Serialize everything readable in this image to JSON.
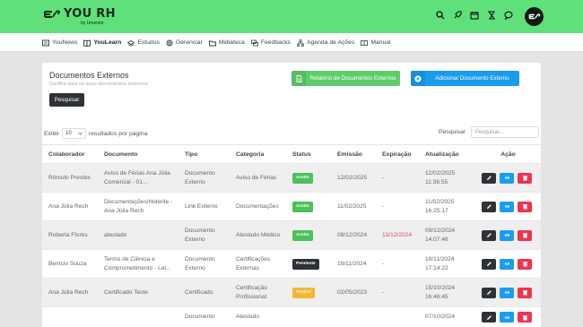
{
  "header": {
    "logo_text": "YOU RH",
    "logo_sub": "by Umentor",
    "icons": [
      "search-icon",
      "rocket-icon",
      "calendar-icon",
      "hourglass-icon",
      "chat-icon"
    ]
  },
  "nav": {
    "items": [
      {
        "label": "YouNews",
        "icon": "news-icon"
      },
      {
        "label": "YouLearn",
        "icon": "book-icon"
      },
      {
        "label": "Estudos",
        "icon": "graduation-icon"
      },
      {
        "label": "Gerenciar",
        "icon": "gear-icon"
      },
      {
        "label": "Midiateca",
        "icon": "folder-icon"
      },
      {
        "label": "Feedbacks",
        "icon": "chat-icon"
      },
      {
        "label": "Agenda de Ações",
        "icon": "network-icon"
      },
      {
        "label": "Manual",
        "icon": "manual-icon"
      }
    ]
  },
  "page": {
    "title": "Documentos Externos",
    "subtitle": "Confira aqui os seus documentos externos",
    "search_button": "Pesquisar",
    "report_button": "Relatório de Documentos Externos",
    "add_button": "Adicionar Documento Externo"
  },
  "controls": {
    "show_prefix": "Exibir",
    "page_size": "10",
    "show_suffix": "resultados por página",
    "search_label": "Pesquisar",
    "search_placeholder": "Pesquisar..."
  },
  "table": {
    "headers": [
      "Colaborador",
      "Documento",
      "Tipo",
      "Categoria",
      "Status",
      "Emissão",
      "Expiração",
      "Atualização",
      "Ação"
    ],
    "rows": [
      {
        "colaborador": "Rômulo Prestes",
        "documento": "Aviso de Férias Ana Júlia Comercial - 01...",
        "tipo": "Documento Externo",
        "categoria": "Aviso de Férias",
        "status": "Aceito",
        "emissao": "12/02/2025",
        "expiracao": "-",
        "atualizacao": "12/02/2025 11:36:55"
      },
      {
        "colaborador": "Ana Júlia Rech",
        "documento": "Documentações/Holerite - Ana Júlia Rech",
        "tipo": "Link Externo",
        "categoria": "Documentações",
        "status": "Aceito",
        "emissao": "11/02/2025",
        "expiracao": "-",
        "atualizacao": "11/02/2025 16:25:17"
      },
      {
        "colaborador": "Roberta Flores",
        "documento": "atestado",
        "tipo": "Documento Externo",
        "categoria": "Atestado Médico",
        "status": "Aceito",
        "emissao": "09/12/2024",
        "expiracao": "13/12/2024",
        "atualizacao": "09/12/2024 14:07:46"
      },
      {
        "colaborador": "Benício Souza",
        "documento": "Termo de Ciência e Comprometimento - Let...",
        "tipo": "Documento Externo",
        "categoria": "Certificações Externas",
        "status": "Pendente",
        "emissao": "19/11/2024",
        "expiracao": "-",
        "atualizacao": "19/11/2024 17:14:22"
      },
      {
        "colaborador": "Ana Júlia Rech",
        "documento": "Certificado Teste",
        "tipo": "Certificado",
        "categoria": "Certificação Profissional",
        "status": "Revisar",
        "emissao": "02/05/2023",
        "expiracao": "-",
        "atualizacao": "15/10/2024 16:46:45"
      },
      {
        "colaborador": "",
        "documento": "",
        "tipo": "Documento",
        "categoria": "Atestado",
        "status": "",
        "emissao": "",
        "expiracao": "",
        "atualizacao": "07/10/2024"
      }
    ]
  },
  "colors": {
    "brand_green": "#5fe07a",
    "status_aceito": "#4cc05a",
    "status_pendente": "#2e3136",
    "status_revisar": "#f5b731",
    "btn_edit": "#2e3136",
    "btn_view": "#1a9cf0",
    "btn_delete": "#f0344e"
  }
}
